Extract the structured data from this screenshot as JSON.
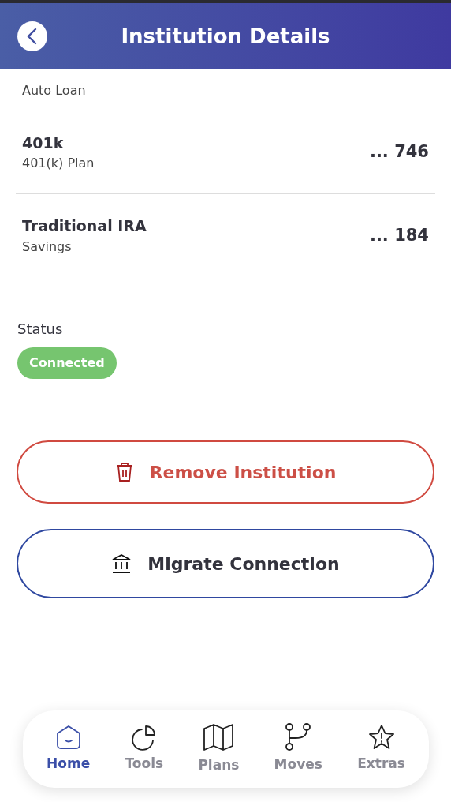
{
  "header": {
    "title": "Institution Details"
  },
  "accounts": [
    {
      "subtitle": "Auto Loan"
    },
    {
      "name": "401k",
      "subtitle": "401(k) Plan",
      "number": "... 746"
    },
    {
      "name": "Traditional IRA",
      "subtitle": "Savings",
      "number": "... 184"
    }
  ],
  "status": {
    "label": "Status",
    "badge": "Connected",
    "color": "#76c56f"
  },
  "buttons": [
    {
      "kind": "remove",
      "label": "Remove Institution"
    },
    {
      "kind": "migrate",
      "label": "Migrate Connection"
    }
  ],
  "nav": [
    {
      "kind": "home",
      "label": "Home",
      "selected": true
    },
    {
      "kind": "tools",
      "label": "Tools",
      "selected": false
    },
    {
      "kind": "plans",
      "label": "Plans",
      "selected": false
    },
    {
      "kind": "moves",
      "label": "Moves",
      "selected": false
    },
    {
      "kind": "extras",
      "label": "Extras",
      "selected": false
    }
  ]
}
